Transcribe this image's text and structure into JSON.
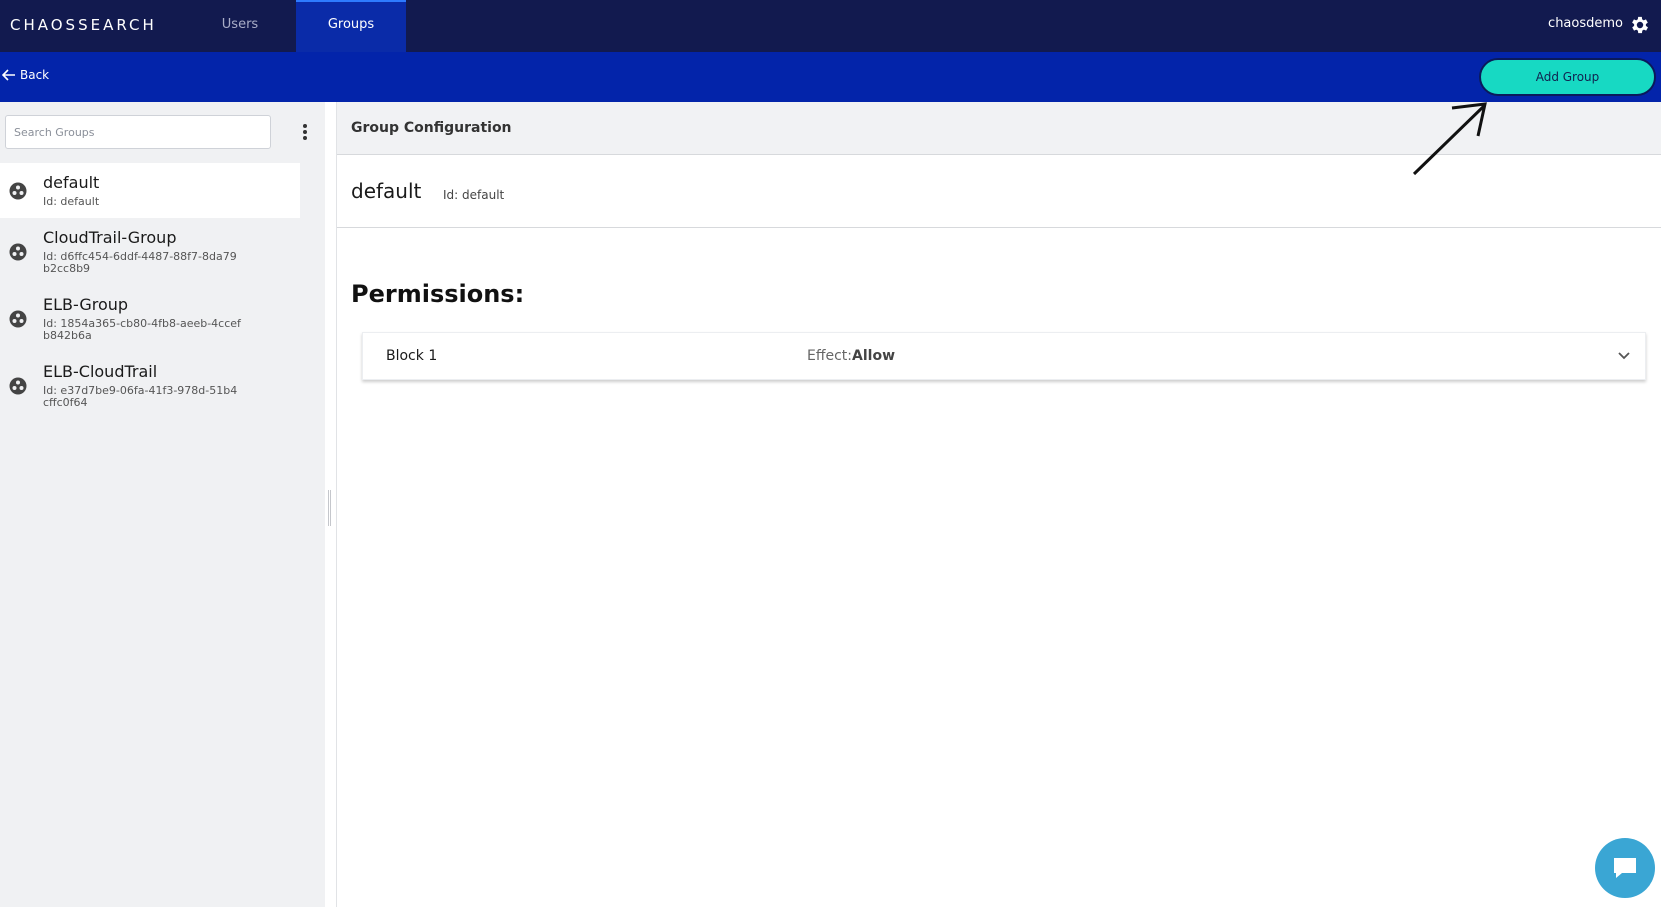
{
  "header": {
    "logo": "CHAOSSEARCH",
    "tabs": [
      {
        "label": "Users"
      },
      {
        "label": "Groups"
      }
    ],
    "username": "chaosdemo",
    "settings_icon": "gear-icon"
  },
  "subbar": {
    "back_label": "Back",
    "add_group_label": "Add Group"
  },
  "sidebar": {
    "search_placeholder": "Search Groups",
    "groups": [
      {
        "name": "default",
        "id": "Id: default"
      },
      {
        "name": "CloudTrail-Group",
        "id": "Id: d6ffc454-6ddf-4487-88f7-8da79b2cc8b9"
      },
      {
        "name": "ELB-Group",
        "id": "Id: 1854a365-cb80-4fb8-aeeb-4ccefb842b6a"
      },
      {
        "name": "ELB-CloudTrail",
        "id": "Id: e37d7be9-06fa-41f3-978d-51b4cffc0f64"
      }
    ]
  },
  "main": {
    "config_title": "Group Configuration",
    "group_title": "default",
    "group_id": "Id: default",
    "permissions_heading": "Permissions:",
    "blocks": [
      {
        "name": "Block 1",
        "effect_label": "Effect:",
        "effect_value": "Allow"
      }
    ]
  },
  "colors": {
    "topbar": "#121a4f",
    "subbar": "#0324aa",
    "accent": "#17d9c3",
    "chat": "#3aa6d4"
  }
}
